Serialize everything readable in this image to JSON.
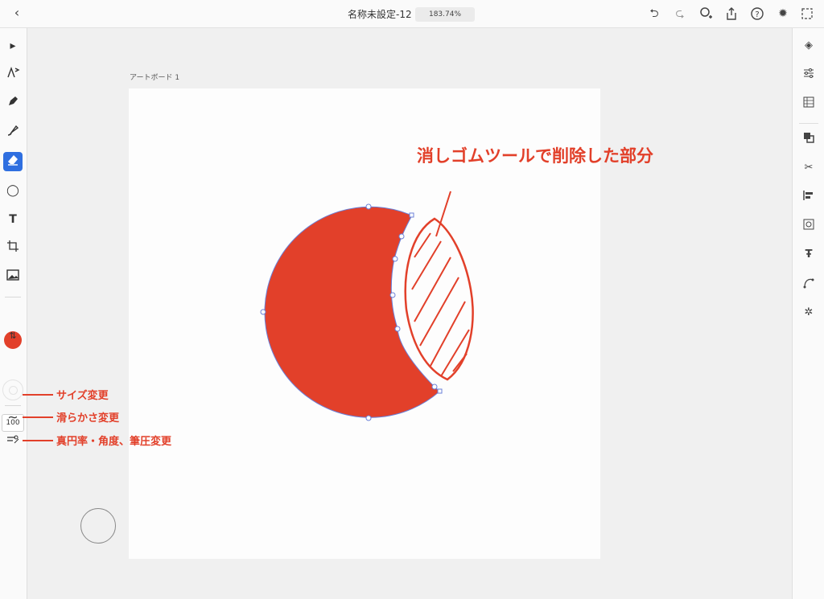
{
  "topbar": {
    "back_icon": "chevron-left-icon",
    "doc_title": "名称未設定-12",
    "zoom": "183.74%",
    "icons": [
      "undo-icon",
      "redo-icon",
      "user-add-icon",
      "share-icon",
      "help-icon",
      "settings-icon",
      "plugin-icon"
    ]
  },
  "left_toolbar": {
    "tools": [
      "select-icon",
      "direct-select-icon",
      "pen-icon",
      "brush-icon",
      "eraser-icon",
      "ellipse-icon",
      "text-icon",
      "crop-icon",
      "image-icon"
    ],
    "active_tool": "eraser-icon",
    "fill_color": "#e2402a",
    "size_value": "100"
  },
  "right_panel": {
    "icons": [
      "layers-icon",
      "properties-icon",
      "libraries-icon",
      "arrange-icon",
      "path-ops-icon",
      "align-icon",
      "repeat-grid-icon",
      "text-style-icon",
      "path-icon",
      "symbols-icon"
    ]
  },
  "canvas": {
    "artboard_label": "アートボード 1",
    "shape_fill": "#e2402a",
    "selection_color": "#5b7ad6"
  },
  "annotations": {
    "eraser_note": "消しゴムツールで削除した部分",
    "size_note": "サイズ変更",
    "smooth_note": "滑らかさ変更",
    "roundness_note": "真円率・角度、筆圧変更"
  }
}
